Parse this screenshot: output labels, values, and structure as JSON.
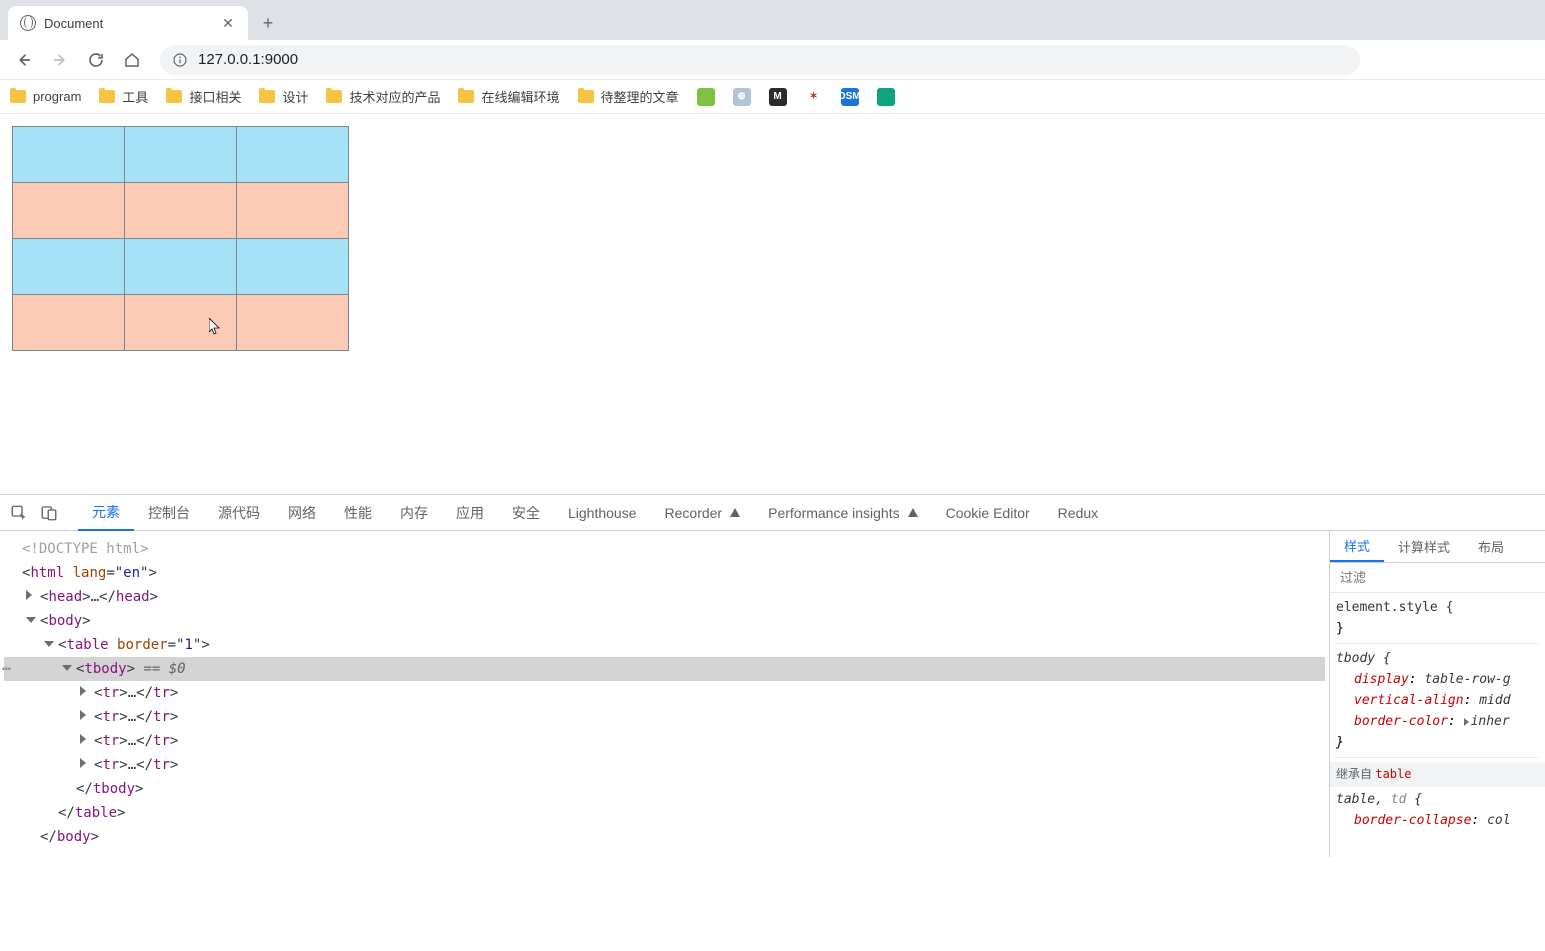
{
  "browser": {
    "tab": {
      "title": "Document"
    },
    "address": "127.0.0.1:9000",
    "bookmarks": [
      {
        "label": "program",
        "type": "folder"
      },
      {
        "label": "工具",
        "type": "folder"
      },
      {
        "label": "接口相关",
        "type": "folder"
      },
      {
        "label": "设计",
        "type": "folder"
      },
      {
        "label": "技术对应的产品",
        "type": "folder"
      },
      {
        "label": "在线编辑环境",
        "type": "folder"
      },
      {
        "label": "待整理的文章",
        "type": "folder"
      }
    ],
    "ext_icons": [
      {
        "bg": "#7fc241",
        "glyph": ""
      },
      {
        "bg": "#b3c4d6",
        "glyph": "⊕"
      },
      {
        "bg": "#2b2b2b",
        "glyph": "M"
      },
      {
        "bg": "#ffffff",
        "glyph": "✶",
        "fg": "#c0392b"
      },
      {
        "bg": "#1976d2",
        "glyph": "DSM"
      },
      {
        "bg": "#10a37f",
        "glyph": ""
      }
    ]
  },
  "page": {
    "table": {
      "rows": 4,
      "cols": 3,
      "row_colors": [
        "blue",
        "peach",
        "blue",
        "peach"
      ]
    }
  },
  "devtools": {
    "tabs": [
      "元素",
      "控制台",
      "源代码",
      "网络",
      "性能",
      "内存",
      "应用",
      "安全",
      "Lighthouse",
      "Recorder",
      "Performance insights",
      "Cookie Editor",
      "Redux"
    ],
    "active_tab": "元素",
    "dom": {
      "l0": "<!DOCTYPE html>",
      "l1_open": "<html ",
      "l1_attr": "lang",
      "l1_eq": "=\"",
      "l1_val": "en",
      "l1_close": "\">",
      "l2": "<head>",
      "l2_dots": "…",
      "l2_end": "</head>",
      "l3": "<body>",
      "l4_open": "<table ",
      "l4_attr": "border",
      "l4_eq": "=\"",
      "l4_val": "1",
      "l4_close": "\">",
      "l5": "<tbody>",
      "l5_suffix": " == $0",
      "l6": "<tr>",
      "l6_dots": "…",
      "l6_end": "</tr>",
      "l7": "</tbody>",
      "l8": "</table>",
      "l9": "</body>"
    },
    "styles": {
      "tabs": [
        "样式",
        "计算样式",
        "布局"
      ],
      "active_tab": "样式",
      "filter_placeholder": "过滤",
      "element_style": "element.style {",
      "close_brace": "}",
      "tbody_sel": "tbody {",
      "tbody_props": [
        {
          "name": "display",
          "val": "table-row-g"
        },
        {
          "name": "vertical-align",
          "val": "midd"
        },
        {
          "name": "border-color",
          "val": "inher",
          "swatch": true
        }
      ],
      "inherit_label": "继承自 ",
      "inherit_from": "table",
      "table_sel": "table, ",
      "table_sel_gray": "td",
      "table_sel_open": " {",
      "table_props": [
        {
          "name": "border-collapse",
          "val": "col",
          "overlay": true
        }
      ]
    }
  }
}
